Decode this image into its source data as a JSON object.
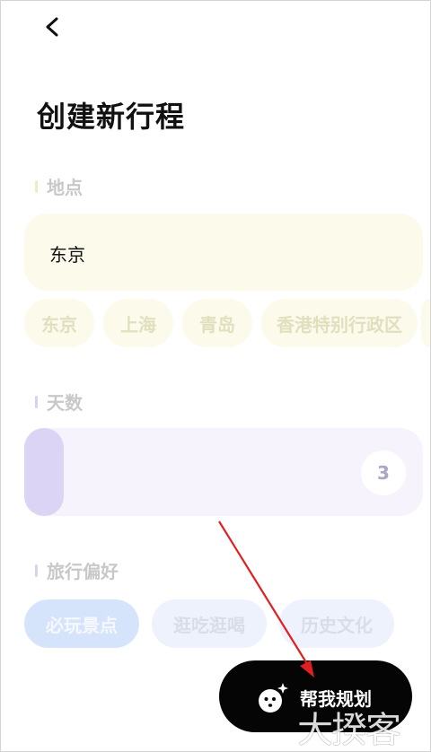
{
  "header": {
    "title": "创建新行程"
  },
  "location": {
    "label": "地点",
    "value": "东京",
    "suggestions": [
      "东京",
      "上海",
      "青岛",
      "香港特别行政区"
    ]
  },
  "days": {
    "label": "天数",
    "value": "3",
    "level_fraction": 0.1
  },
  "preferences": {
    "label": "旅行偏好",
    "options": [
      "必玩景点",
      "逛吃逛喝",
      "历史文化"
    ],
    "selected": "必玩景点"
  },
  "plan_button": {
    "label": "帮我规划",
    "icon": "ghost-sparkle-icon"
  },
  "watermark": {
    "text": "大揆客"
  },
  "colors": {
    "location_bar": "#f1ecc0",
    "days_bar": "#d7d3ef",
    "pref_bar": "#d2d6e6",
    "arrow": "#e02020",
    "button_bg": "#050505"
  }
}
